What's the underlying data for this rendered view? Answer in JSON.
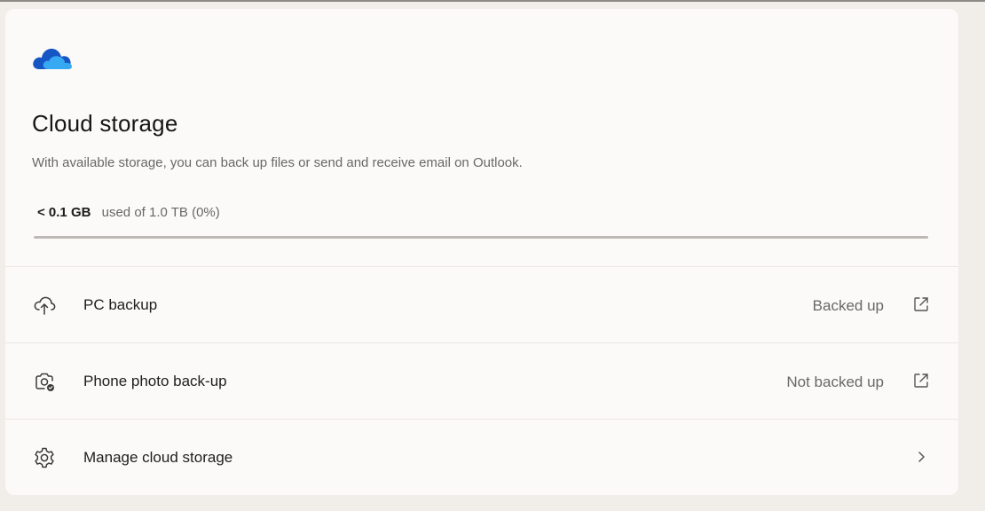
{
  "card": {
    "logo_icon": "onedrive-cloud-icon",
    "title": "Cloud storage",
    "description": "With available storage, you can back up files or send and receive email on Outlook.",
    "usage": {
      "amount": "< 0.1 GB",
      "detail": "used of 1.0 TB (0%)",
      "fraction": 0.0
    }
  },
  "rows": [
    {
      "icon": "cloud-upload-icon",
      "label": "PC backup",
      "status": "Backed up",
      "action_icon": "open-external-icon"
    },
    {
      "icon": "camera-sync-icon",
      "label": "Phone photo back-up",
      "status": "Not backed up",
      "action_icon": "open-external-icon"
    },
    {
      "icon": "gear-icon",
      "label": "Manage cloud storage",
      "status": "",
      "action_icon": "chevron-right-icon"
    }
  ],
  "colors": {
    "accent": "#0f6cbd",
    "cloud_dark": "#1656c4",
    "cloud_light": "#36a9f2"
  }
}
